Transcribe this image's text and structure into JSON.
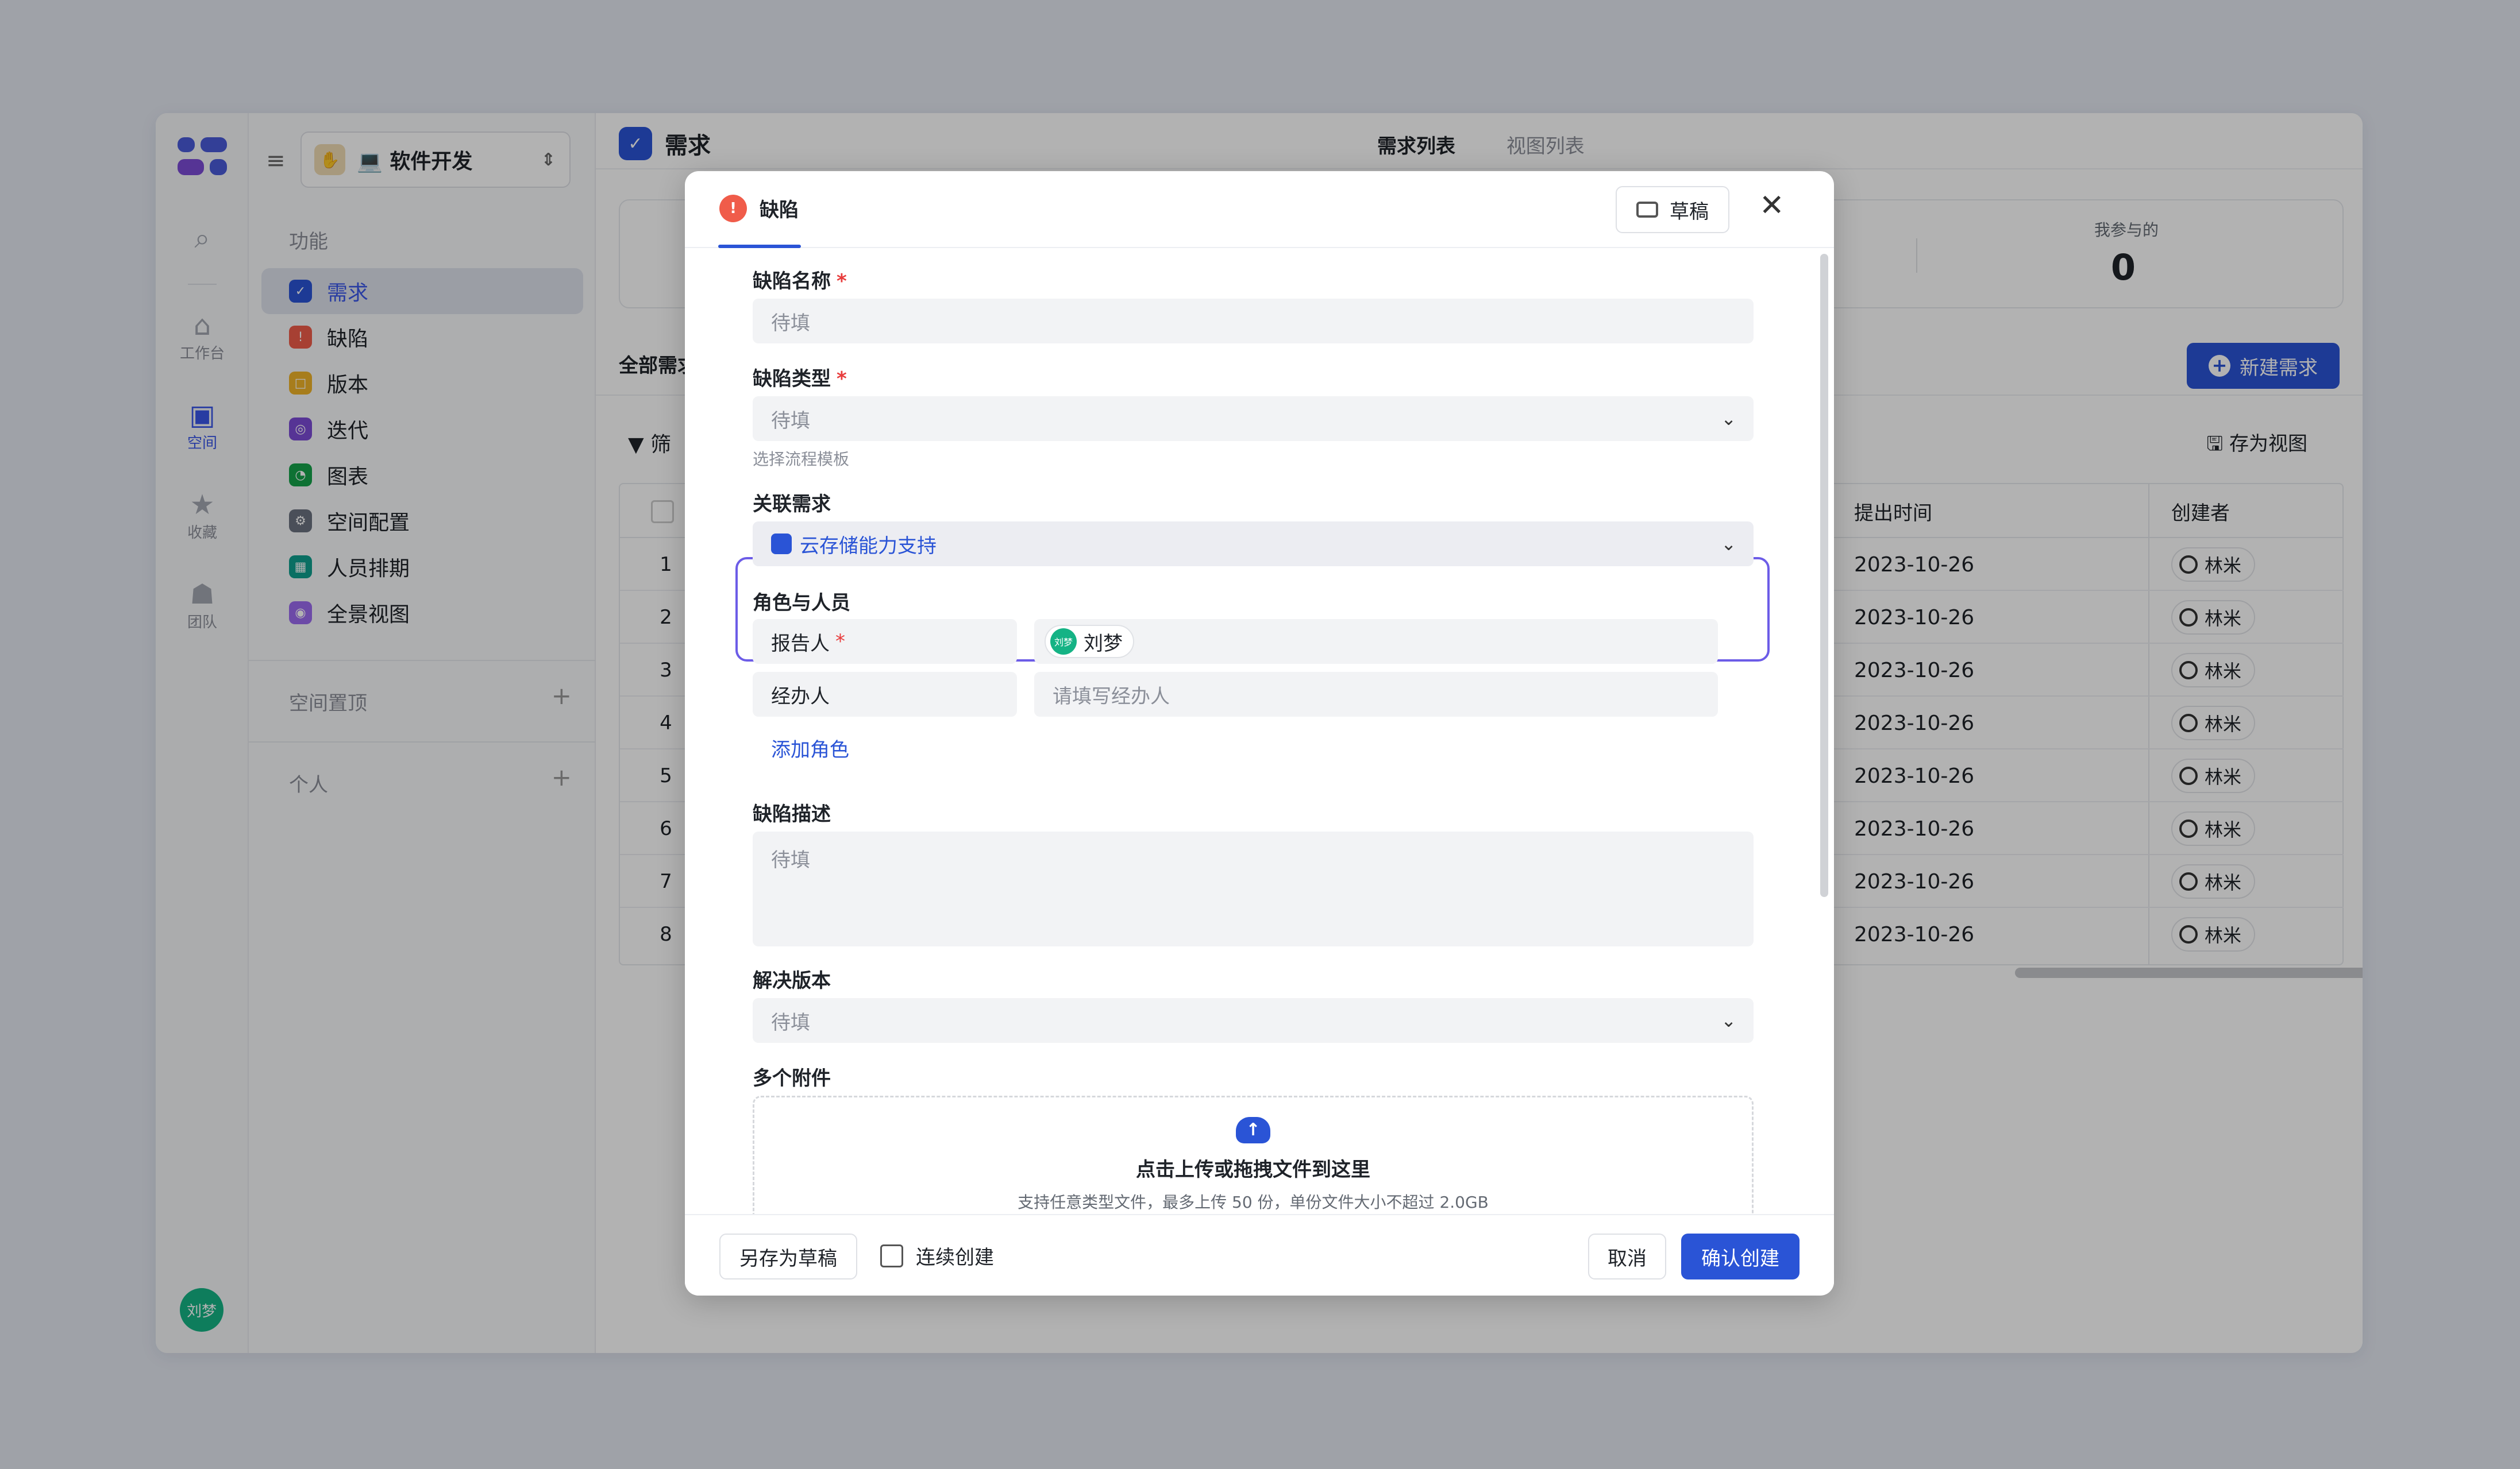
{
  "app": {
    "rail": {
      "items": [
        {
          "icon": "search-icon",
          "label": ""
        },
        {
          "icon": "home-icon",
          "label": "工作台"
        },
        {
          "icon": "space-icon",
          "label": "空间"
        },
        {
          "icon": "star-icon",
          "label": "收藏"
        },
        {
          "icon": "team-icon",
          "label": "团队"
        }
      ],
      "user_avatar": "刘梦"
    },
    "sidebar": {
      "project_name": "💻 软件开发",
      "section_features": "功能",
      "items": [
        {
          "label": "需求",
          "color": "#2a54d6"
        },
        {
          "label": "缺陷",
          "color": "#f05c4a"
        },
        {
          "label": "版本",
          "color": "#f0b429"
        },
        {
          "label": "迭代",
          "color": "#7b4bd6"
        },
        {
          "label": "图表",
          "color": "#15a34a"
        },
        {
          "label": "空间配置",
          "color": "#6b7280"
        },
        {
          "label": "人员排期",
          "color": "#0f9f8f"
        },
        {
          "label": "全景视图",
          "color": "#9b6bef"
        }
      ],
      "section_pinned": "空间置顶",
      "section_personal": "个人"
    },
    "header": {
      "title": "需求",
      "tabs": [
        "需求列表",
        "视图列表"
      ]
    },
    "stats": {
      "label": "我参与的",
      "value": "0"
    },
    "toolbar": {
      "new_button": "新建需求",
      "all_tab": "全部需求",
      "filter": "筛",
      "save_view": "存为视图"
    },
    "table": {
      "headers": [
        "提出时间",
        "创建者"
      ],
      "rows": [
        {
          "num": "1",
          "date": "2023-10-26",
          "creator": "林米"
        },
        {
          "num": "2",
          "date": "2023-10-26",
          "creator": "林米"
        },
        {
          "num": "3",
          "date": "2023-10-26",
          "creator": "林米"
        },
        {
          "num": "4",
          "date": "2023-10-26",
          "creator": "林米"
        },
        {
          "num": "5",
          "date": "2023-10-26",
          "creator": "林米"
        },
        {
          "num": "6",
          "date": "2023-10-26",
          "creator": "林米"
        },
        {
          "num": "7",
          "date": "2023-10-26",
          "creator": "林米"
        },
        {
          "num": "8",
          "date": "2023-10-26",
          "creator": "林米"
        }
      ]
    }
  },
  "modal": {
    "tab": "缺陷",
    "draft_button": "草稿",
    "fields": {
      "name": {
        "label": "缺陷名称",
        "placeholder": "待填"
      },
      "type": {
        "label": "缺陷类型",
        "placeholder": "待填",
        "hint": "选择流程模板"
      },
      "linked": {
        "label": "关联需求",
        "value": "云存储能力支持"
      },
      "roles": {
        "label": "角色与人员",
        "reporter": {
          "label": "报告人",
          "value": "刘梦",
          "avatar": "刘梦"
        },
        "assignee": {
          "label": "经办人",
          "placeholder": "请填写经办人"
        },
        "add": "添加角色"
      },
      "desc": {
        "label": "缺陷描述",
        "placeholder": "待填"
      },
      "version": {
        "label": "解决版本",
        "placeholder": "待填"
      },
      "attachments": {
        "label": "多个附件",
        "title": "点击上传或拖拽文件到这里",
        "subtitle": "支持任意类型文件，最多上传 50 份，单份文件大小不超过 2.0GB"
      }
    },
    "footer": {
      "save_draft": "另存为草稿",
      "continuous": "连续创建",
      "cancel": "取消",
      "confirm": "确认创建"
    }
  }
}
